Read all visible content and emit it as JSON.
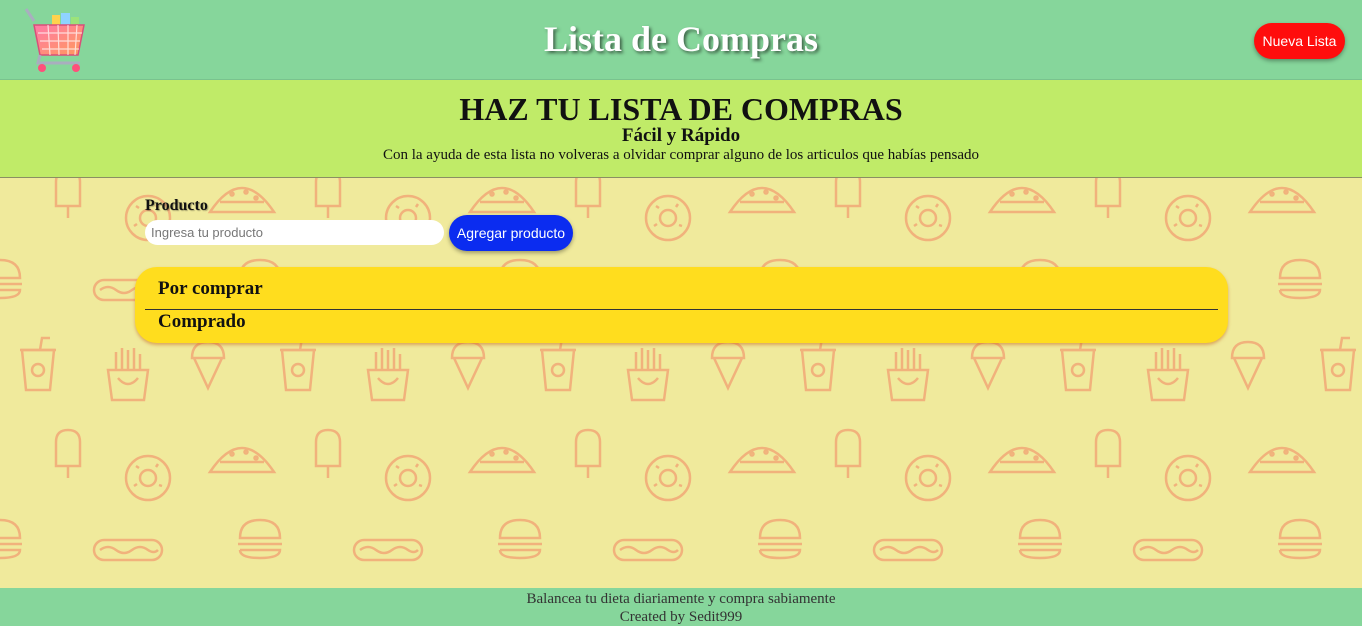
{
  "header": {
    "title": "Lista de Compras",
    "new_list_label": "Nueva Lista",
    "logo_icon": "shopping-cart-icon"
  },
  "hero": {
    "heading": "HAZ TU LISTA DE COMPRAS",
    "subheading": "Fácil y Rápido",
    "description": "Con la ayuda de esta lista no volveras a olvidar comprar alguno de los articulos que habías pensado"
  },
  "form": {
    "label": "Producto",
    "placeholder": "Ingresa tu producto",
    "value": "",
    "add_label": "Agregar producto"
  },
  "list": {
    "pending_title": "Por comprar",
    "done_title": "Comprado"
  },
  "footer": {
    "line1": "Balancea tu dieta diariamente y compra sabiamente",
    "line2": "Created by Sedit999"
  },
  "colors": {
    "header_bg": "#86d69b",
    "hero_bg": "#c0eb68",
    "page_bg": "#f0ea9c",
    "pattern_stroke": "#f1b27c",
    "new_list_btn": "#ff0d0d",
    "add_btn": "#0b2cf0",
    "list_card": "#ffdd1e"
  }
}
